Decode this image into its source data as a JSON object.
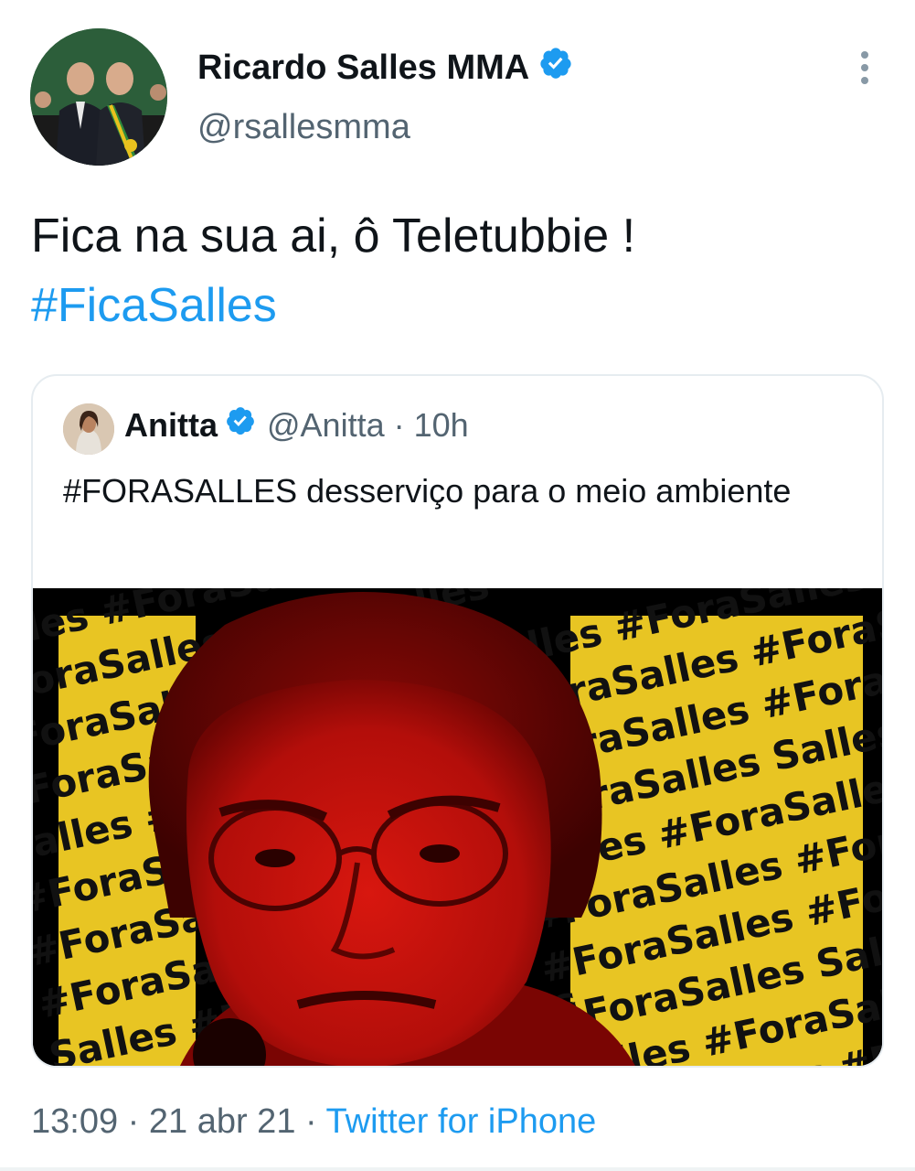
{
  "author": {
    "display_name": "Ricardo Salles MMA",
    "handle": "@rsallesmma",
    "verified_icon": "verified-badge-icon"
  },
  "tweet": {
    "text": "Fica na sua ai, ô Teletubbie !",
    "hashtag": "#FicaSalles"
  },
  "quoted_tweet": {
    "display_name": "Anitta",
    "handle": "@Anitta",
    "separator": "·",
    "time": "10h",
    "text": "#FORASALLES desserviço para o meio ambiente",
    "media_background_words": [
      "Salles",
      "#ForaSalles",
      "#ForaSalles",
      "#ForaSalles"
    ]
  },
  "footer": {
    "time": "13:09",
    "separator": "·",
    "date": "21 abr 21",
    "source": "Twitter for iPhone"
  },
  "colors": {
    "link": "#1d9bf0",
    "secondary_text": "#536471",
    "verified": "#1d9bf0",
    "media_yellow": "#e8c523",
    "media_red": "#c4120e"
  }
}
